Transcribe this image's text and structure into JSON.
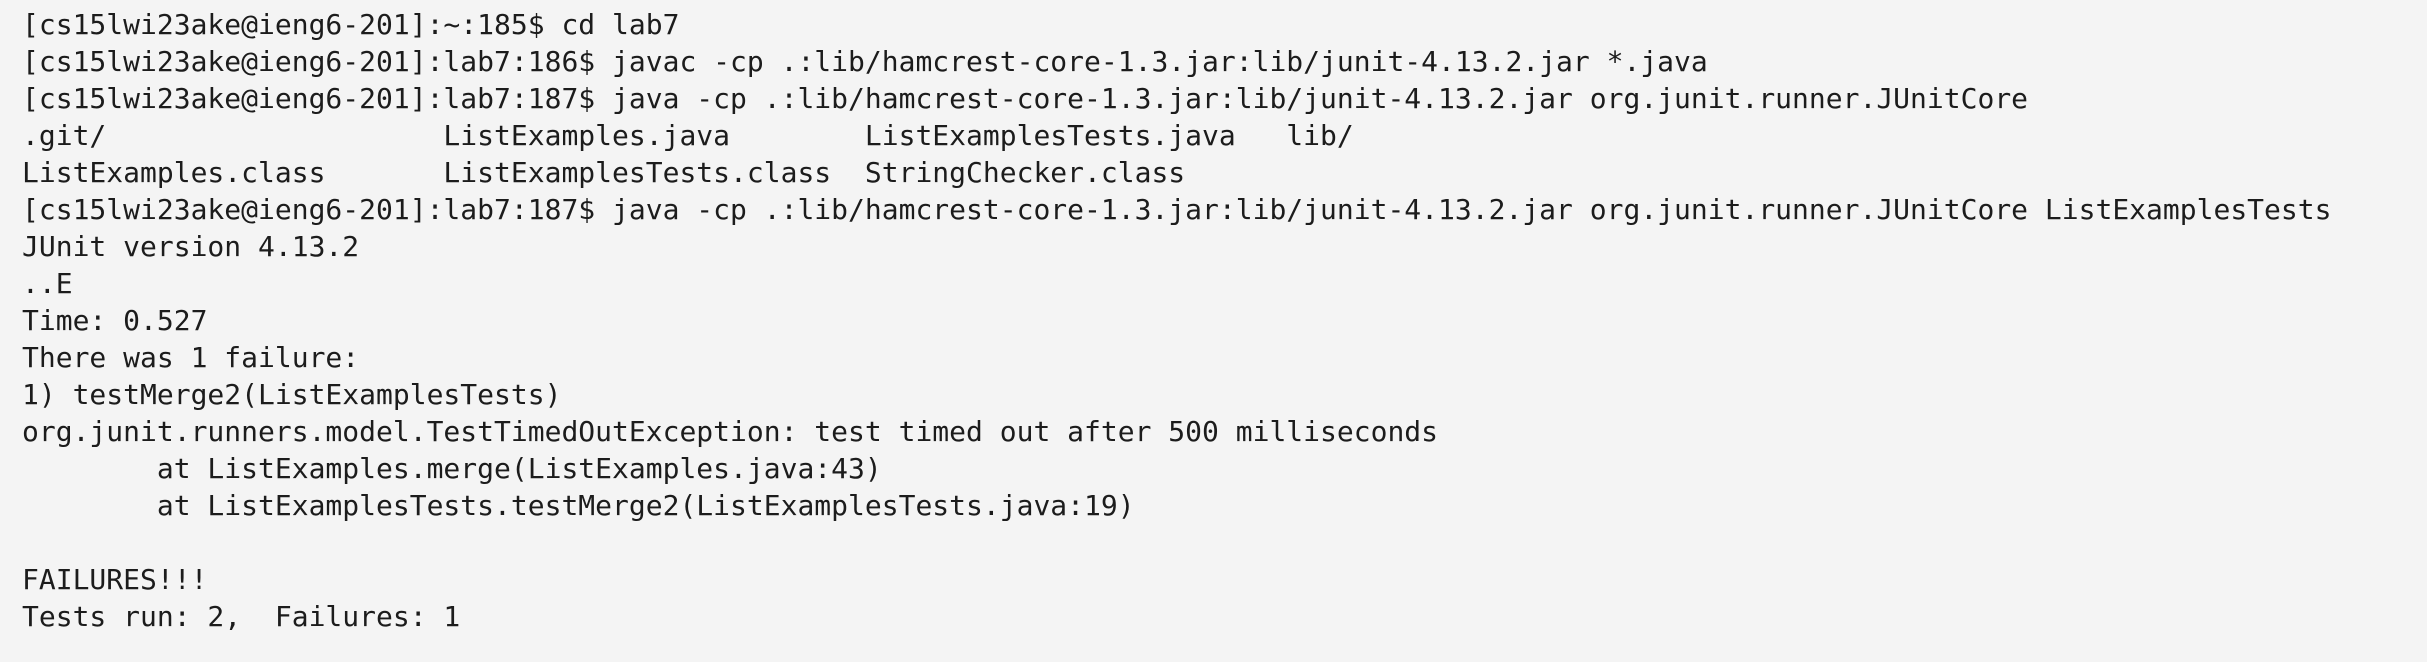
{
  "terminal": {
    "lines": [
      "[cs15lwi23ake@ieng6-201]:~:185$ cd lab7",
      "[cs15lwi23ake@ieng6-201]:lab7:186$ javac -cp .:lib/hamcrest-core-1.3.jar:lib/junit-4.13.2.jar *.java",
      "[cs15lwi23ake@ieng6-201]:lab7:187$ java -cp .:lib/hamcrest-core-1.3.jar:lib/junit-4.13.2.jar org.junit.runner.JUnitCore",
      ".git/                    ListExamples.java        ListExamplesTests.java   lib/",
      "ListExamples.class       ListExamplesTests.class  StringChecker.class",
      "[cs15lwi23ake@ieng6-201]:lab7:187$ java -cp .:lib/hamcrest-core-1.3.jar:lib/junit-4.13.2.jar org.junit.runner.JUnitCore ListExamplesTests",
      "JUnit version 4.13.2",
      "..E",
      "Time: 0.527",
      "There was 1 failure:",
      "1) testMerge2(ListExamplesTests)",
      "org.junit.runners.model.TestTimedOutException: test timed out after 500 milliseconds",
      "        at ListExamples.merge(ListExamples.java:43)",
      "        at ListExamplesTests.testMerge2(ListExamplesTests.java:19)",
      "",
      "FAILURES!!!",
      "Tests run: 2,  Failures: 1"
    ]
  }
}
